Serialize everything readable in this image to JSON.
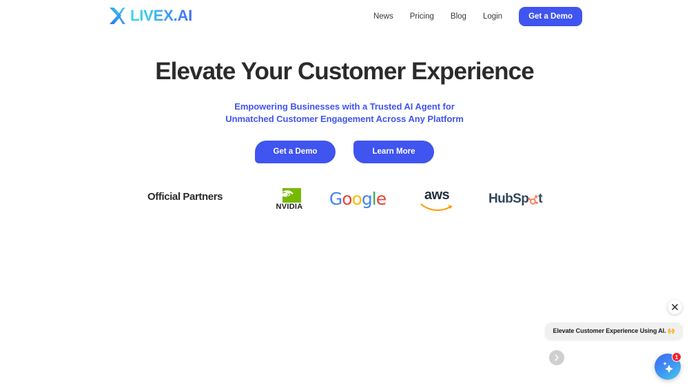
{
  "brand": {
    "logo_text": "LIVEX.AI",
    "logo_mark_icon": "x-chevron-logo-icon",
    "gradient_from": "#3ad8e8",
    "gradient_to": "#3f6ff5"
  },
  "nav": {
    "items": [
      {
        "label": "News"
      },
      {
        "label": "Pricing"
      },
      {
        "label": "Blog"
      },
      {
        "label": "Login"
      }
    ],
    "cta_label": "Get a Demo",
    "cta_color": "#4054f0"
  },
  "hero": {
    "headline": "Elevate Your Customer Experience",
    "subheadline": "Empowering Businesses with a Trusted AI Agent  for\nUnmatched Customer Engagement Across Any Platform",
    "subheadline_color": "#4054f0",
    "primary_cta": "Get a Demo",
    "secondary_cta": "Learn More"
  },
  "partners": {
    "label": "Official Partners",
    "logos": [
      {
        "name": "NVIDIA",
        "wordmark": "NVIDIA",
        "color": "#76b900",
        "icon": "nvidia-eye-icon"
      },
      {
        "name": "Google",
        "wordmark": "Google",
        "letters": [
          "G",
          "o",
          "o",
          "g",
          "l",
          "e"
        ]
      },
      {
        "name": "AWS",
        "wordmark": "aws",
        "color": "#ff9900",
        "icon": "aws-smile-icon"
      },
      {
        "name": "HubSpot",
        "wordmark_start": "HubSp",
        "wordmark_end": "t",
        "color": "#ff7a59",
        "icon": "hubspot-sprocket-icon"
      }
    ]
  },
  "widgets": {
    "close_icon": "close-icon",
    "carousel_next_icon": "chevron-right-icon",
    "chat_message": "Elevate Customer Experience Using AI. 🙌",
    "launcher_icon": "sparkle-icon",
    "launcher_badge": "1",
    "badge_color": "#f5222d"
  }
}
